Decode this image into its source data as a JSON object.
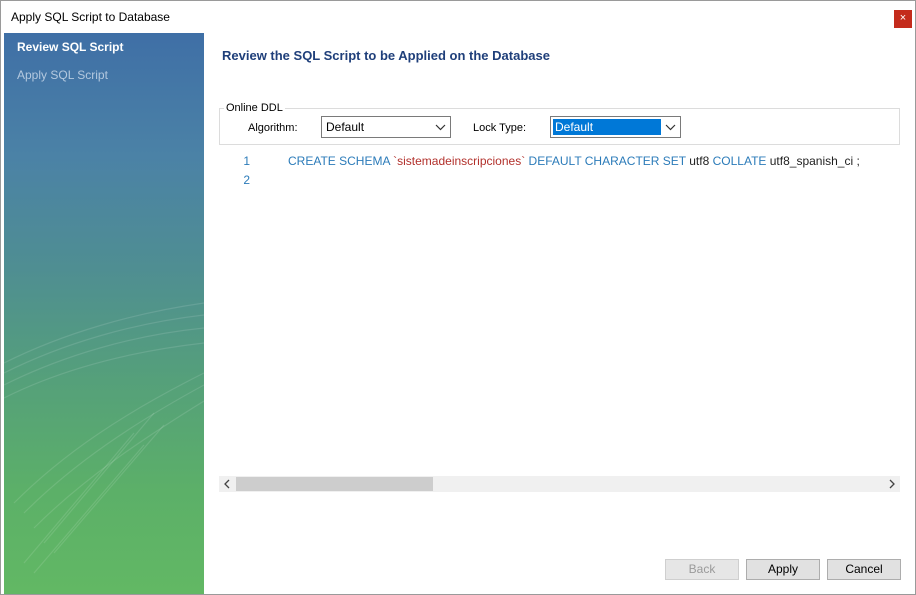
{
  "window": {
    "title": "Apply SQL Script to Database",
    "close_glyph": "×"
  },
  "sidebar": {
    "steps": [
      {
        "label": "Review SQL Script",
        "state": "active"
      },
      {
        "label": "Apply SQL Script",
        "state": "inactive"
      }
    ]
  },
  "main": {
    "heading": "Review the SQL Script to be Applied on the Database",
    "online_ddl": {
      "legend": "Online DDL",
      "algorithm_label": "Algorithm:",
      "algorithm_value": "Default",
      "lock_type_label": "Lock Type:",
      "lock_type_value": "Default"
    },
    "script": {
      "line_numbers": [
        "1",
        "2"
      ],
      "line1": {
        "create_schema": "CREATE SCHEMA",
        "schema_name": "`sistemadeinscripciones`",
        "default_charset": "DEFAULT CHARACTER SET",
        "charset": "utf8",
        "collate": "COLLATE",
        "collation": "utf8_spanish_ci ;"
      }
    }
  },
  "footer": {
    "back_label": "Back",
    "apply_label": "Apply",
    "cancel_label": "Cancel"
  },
  "icons": {
    "close": "close-icon",
    "dropdown": "chevron-down-icon",
    "scroll_left": "scroll-left-icon",
    "scroll_right": "scroll-right-icon"
  },
  "colors": {
    "heading": "#1f3f7a",
    "keyword": "#2b7bb9",
    "string": "#b2302b",
    "selection": "#0078d7",
    "close": "#c42b1c"
  }
}
